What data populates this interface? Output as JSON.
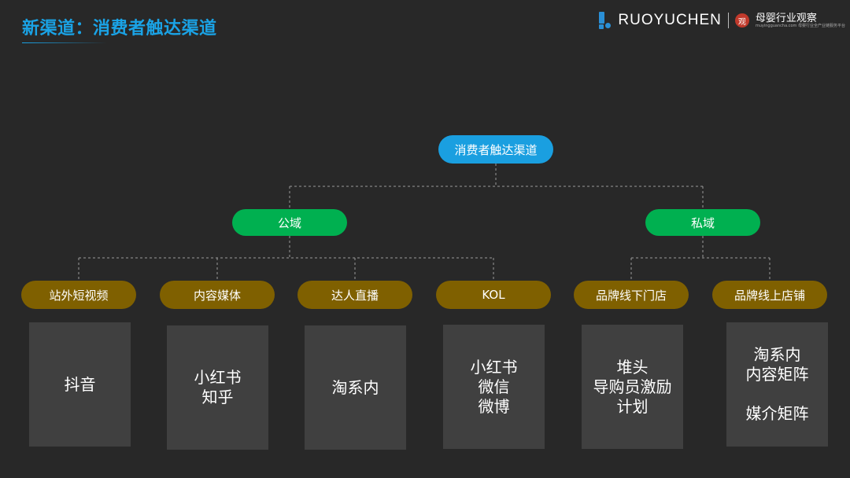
{
  "header": {
    "title": "新渠道：消费者触达渠道",
    "brand": "RUOYUCHEN",
    "partner_badge": "观",
    "partner": "母婴行业观察",
    "partner_sub": "muyingguancha.com 母婴行业全产业链服务平台"
  },
  "diagram": {
    "root": "消费者触达渠道",
    "branches": [
      {
        "label": "公域",
        "channels": [
          {
            "label": "站外短视频",
            "detail": "抖音"
          },
          {
            "label": "内容媒体",
            "detail": "小红书\n知乎"
          },
          {
            "label": "达人直播",
            "detail": "淘系内"
          },
          {
            "label": "KOL",
            "detail": "小红书\n微信\n微博"
          }
        ]
      },
      {
        "label": "私域",
        "channels": [
          {
            "label": "品牌线下门店",
            "detail": "堆头\n导购员激励\n计划"
          },
          {
            "label": "品牌线上店铺",
            "detail": "淘系内\n内容矩阵\n\n媒介矩阵"
          }
        ]
      }
    ]
  },
  "colors": {
    "background": "#282828",
    "title": "#1aa3e6",
    "root": "#1a9fe0",
    "branch": "#00b050",
    "channel": "#7f6000",
    "detail_box": "#404040",
    "connector": "#9a9a9a"
  }
}
